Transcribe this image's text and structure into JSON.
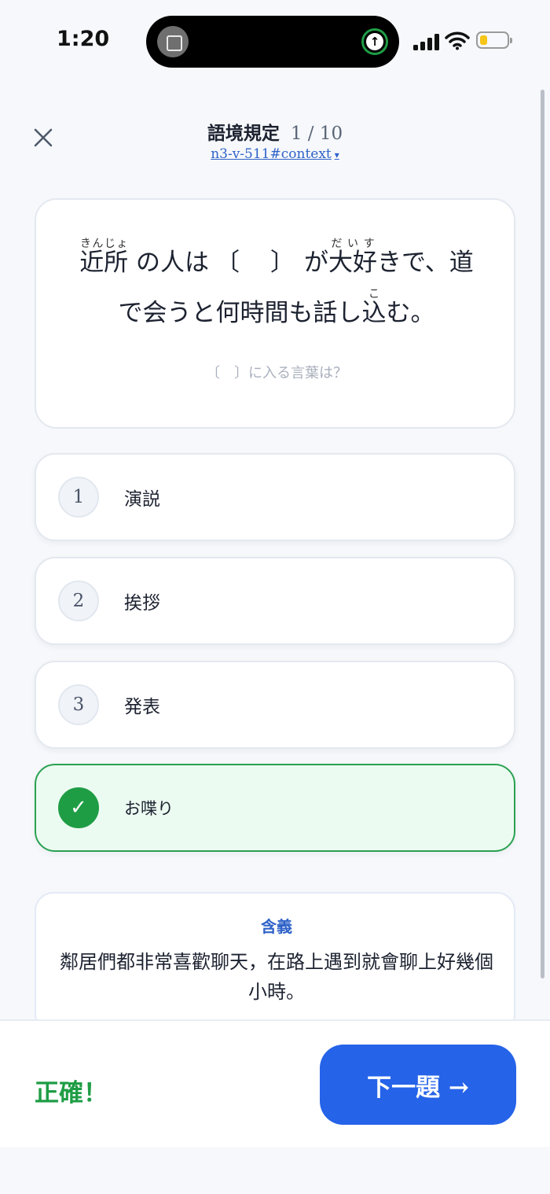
{
  "status_bar": {
    "time": "1:20",
    "icons": [
      "photo-icon",
      "upload-arrow-icon",
      "signal-icon",
      "wifi-icon",
      "battery-icon"
    ],
    "upload_glyph": "↑"
  },
  "header": {
    "title": "語境規定",
    "progress": "1 / 10",
    "question_id": "n3-v-511#context",
    "caret": "▾",
    "close_glyph": "close-icon"
  },
  "question": {
    "w1_base": "近所",
    "w1_ruby": "きんじょ",
    "part1": "の人は",
    "blank": "〔　〕",
    "part2": "が",
    "w2_base": "大好",
    "w2_ruby": "だいす",
    "part3": "きで、道で会うと何時間も話し",
    "w3_base": "込",
    "w3_ruby": "こ",
    "part4": "む。",
    "hint": "〔　〕に入る言葉は？"
  },
  "options": [
    {
      "number": "1",
      "label": "演説",
      "state": "default"
    },
    {
      "number": "2",
      "label": "挨拶",
      "state": "default"
    },
    {
      "number": "3",
      "label": "発表",
      "state": "default"
    },
    {
      "number": "✓",
      "label": "お喋り",
      "state": "correct"
    }
  ],
  "explanation": {
    "title": "含義",
    "body": "鄰居們都非常喜歡聊天，在路上遇到就會聊上好幾個小時。"
  },
  "footer": {
    "result": "正確！",
    "next_label": "下一題 →"
  },
  "colors": {
    "accent_blue": "#2563e8",
    "correct_green": "#1f9d45",
    "correct_bg": "#ecfbf1"
  }
}
